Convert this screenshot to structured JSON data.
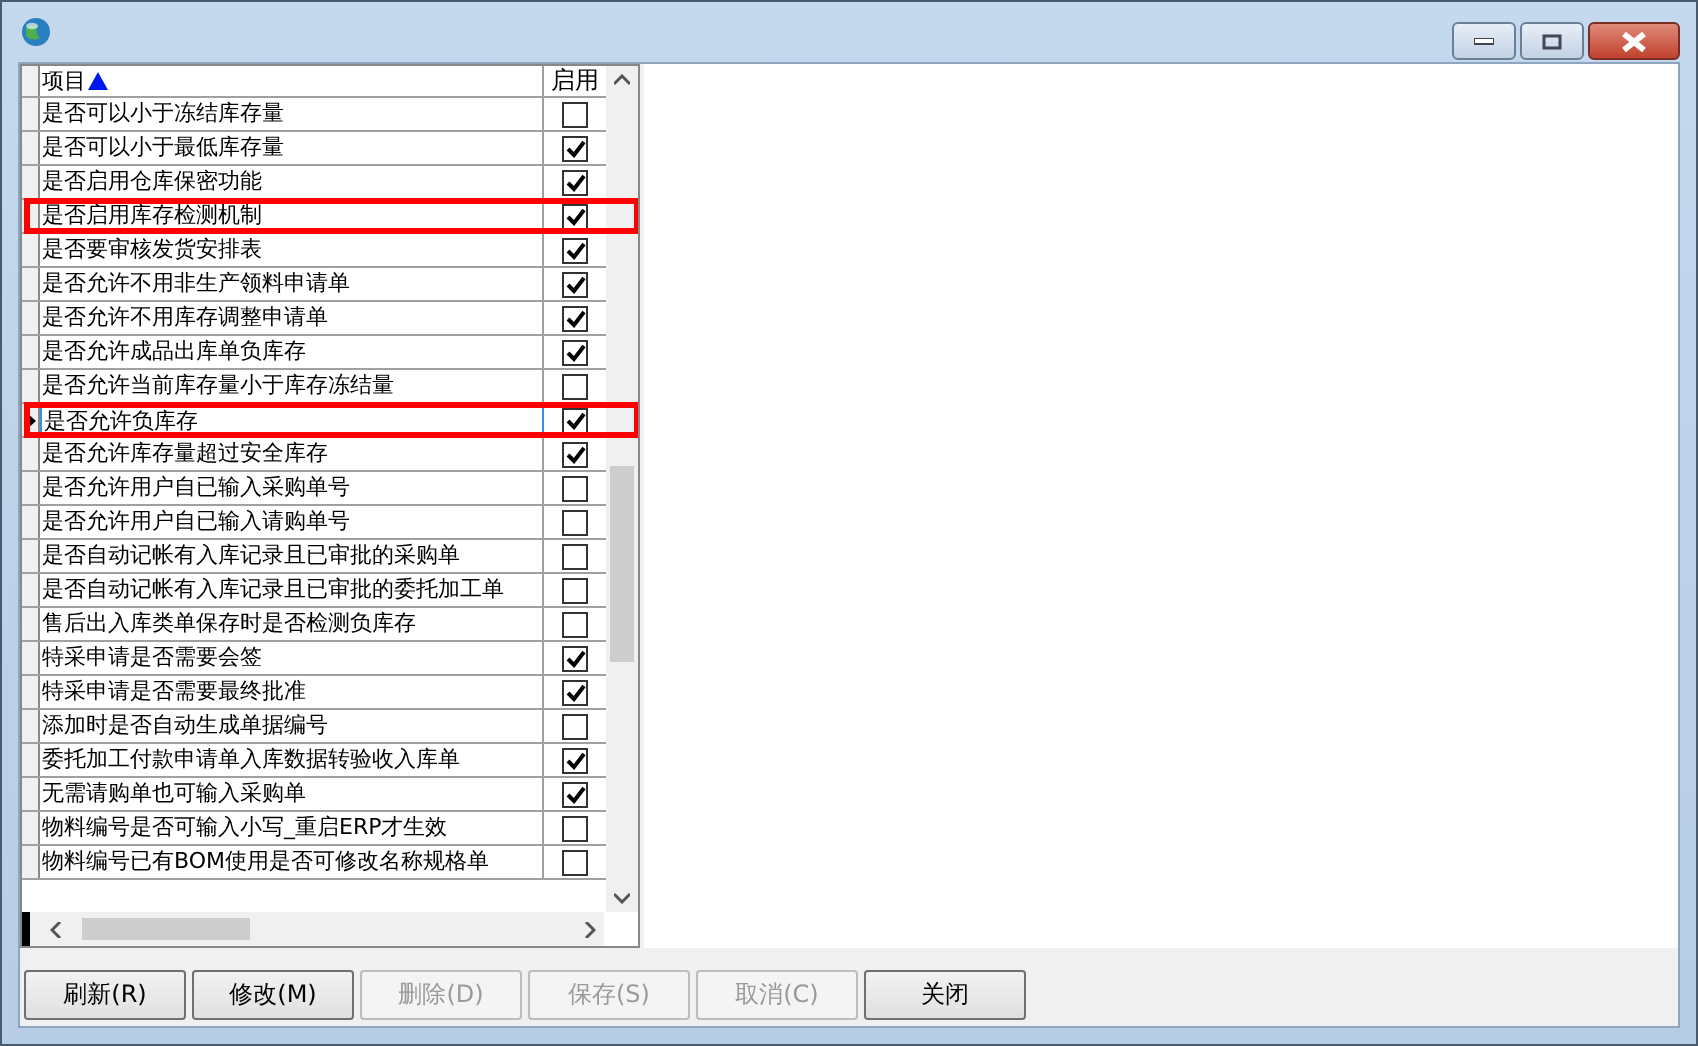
{
  "grid": {
    "columns": [
      {
        "label": "项目"
      },
      {
        "label": "启用"
      }
    ],
    "rows": [
      {
        "label": "是否可以小于冻结库存量",
        "checked": false,
        "selected": false,
        "highlighted": false
      },
      {
        "label": "是否可以小于最低库存量",
        "checked": true,
        "selected": false,
        "highlighted": false
      },
      {
        "label": "是否启用仓库保密功能",
        "checked": true,
        "selected": false,
        "highlighted": false
      },
      {
        "label": "是否启用库存检测机制",
        "checked": true,
        "selected": false,
        "highlighted": true
      },
      {
        "label": "是否要审核发货安排表",
        "checked": true,
        "selected": false,
        "highlighted": false
      },
      {
        "label": "是否允许不用非生产领料申请单",
        "checked": true,
        "selected": false,
        "highlighted": false
      },
      {
        "label": "是否允许不用库存调整申请单",
        "checked": true,
        "selected": false,
        "highlighted": false
      },
      {
        "label": "是否允许成品出库单负库存",
        "checked": true,
        "selected": false,
        "highlighted": false
      },
      {
        "label": "是否允许当前库存量小于库存冻结量",
        "checked": false,
        "selected": false,
        "highlighted": false
      },
      {
        "label": "是否允许负库存",
        "checked": true,
        "selected": true,
        "highlighted": true
      },
      {
        "label": "是否允许库存量超过安全库存",
        "checked": true,
        "selected": false,
        "highlighted": false
      },
      {
        "label": "是否允许用户自已输入采购单号",
        "checked": false,
        "selected": false,
        "highlighted": false
      },
      {
        "label": "是否允许用户自已输入请购单号",
        "checked": false,
        "selected": false,
        "highlighted": false
      },
      {
        "label": "是否自动记帐有入库记录且已审批的采购单",
        "checked": false,
        "selected": false,
        "highlighted": false
      },
      {
        "label": "是否自动记帐有入库记录且已审批的委托加工单",
        "checked": false,
        "selected": false,
        "highlighted": false
      },
      {
        "label": "售后出入库类单保存时是否检测负库存",
        "checked": false,
        "selected": false,
        "highlighted": false
      },
      {
        "label": "特采申请是否需要会签",
        "checked": true,
        "selected": false,
        "highlighted": false
      },
      {
        "label": "特采申请是否需要最终批准",
        "checked": true,
        "selected": false,
        "highlighted": false
      },
      {
        "label": "添加时是否自动生成单据编号",
        "checked": false,
        "selected": false,
        "highlighted": false
      },
      {
        "label": "委托加工付款申请单入库数据转验收入库单",
        "checked": true,
        "selected": false,
        "highlighted": false
      },
      {
        "label": "无需请购单也可输入采购单",
        "checked": true,
        "selected": false,
        "highlighted": false
      },
      {
        "label": "物料编号是否可输入小写_重启ERP才生效",
        "checked": false,
        "selected": false,
        "highlighted": false
      },
      {
        "label": "物料编号已有BOM使用是否可修改名称规格单",
        "checked": false,
        "selected": false,
        "highlighted": false
      }
    ]
  },
  "buttons": [
    {
      "label": "刷新(R)",
      "disabled": false
    },
    {
      "label": "修改(M)",
      "disabled": false
    },
    {
      "label": "删除(D)",
      "disabled": true
    },
    {
      "label": "保存(S)",
      "disabled": true
    },
    {
      "label": "取消(C)",
      "disabled": true
    },
    {
      "label": "关闭",
      "disabled": false
    }
  ]
}
